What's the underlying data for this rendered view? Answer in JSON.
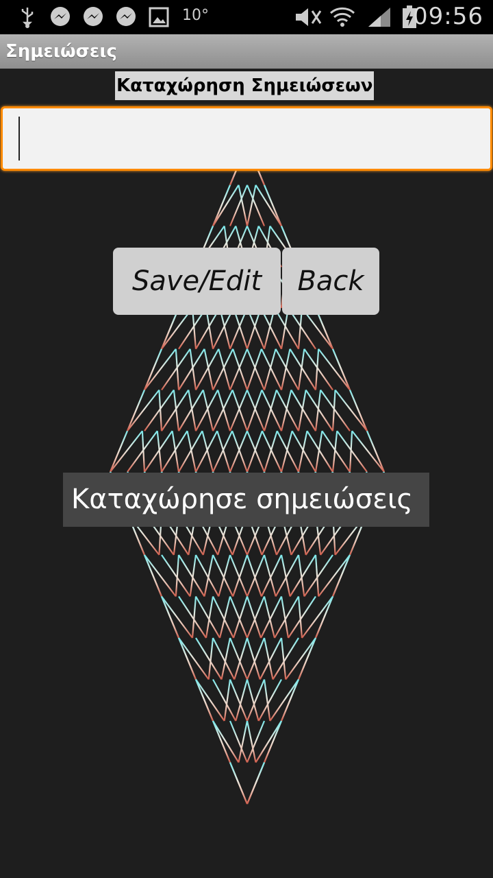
{
  "status_bar": {
    "temperature": "10°",
    "time": "09:56",
    "icons": [
      "usb-icon",
      "messenger-icon",
      "messenger-icon",
      "messenger-icon",
      "image-icon",
      "mute-icon",
      "wifi-icon",
      "signal-icon",
      "battery-icon"
    ]
  },
  "app_bar": {
    "title": "Σημειώσεις"
  },
  "main": {
    "heading": "Καταχώρηση Σημειώσεων",
    "note_input": {
      "value": ""
    },
    "save_button": "Save/Edit",
    "back_button": "Back",
    "toast": "Καταχώρησε σημειώσεις"
  },
  "colors": {
    "accent": "#ff8a00",
    "background": "#1e1e1e"
  }
}
